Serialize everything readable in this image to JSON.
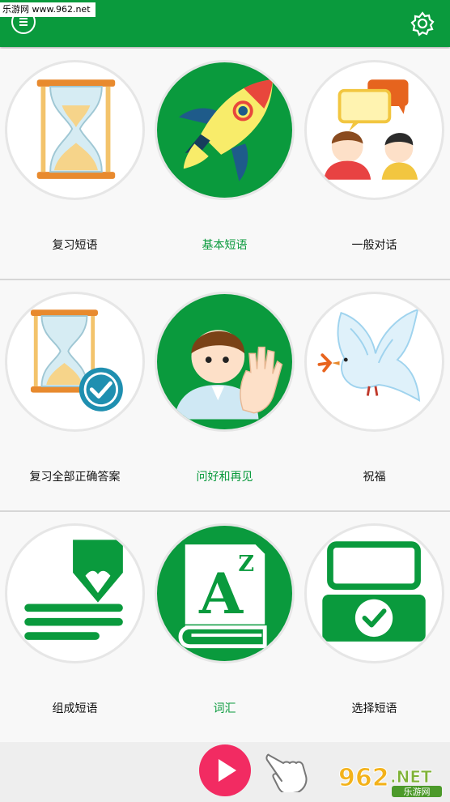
{
  "watermark_top": "乐游网 www.962.net",
  "header": {
    "menu_icon": "hamburger-menu-icon",
    "settings_icon": "gear-icon",
    "color": "#0a9a3d"
  },
  "sections": [
    {
      "items": [
        {
          "label": "复习短语",
          "icon": "hourglass-icon",
          "active": false
        },
        {
          "label": "基本短语",
          "icon": "rocket-icon",
          "active": true
        },
        {
          "label": "一般对话",
          "icon": "conversation-icon",
          "active": false
        }
      ]
    },
    {
      "items": [
        {
          "label": "复习全部正确答案",
          "icon": "hourglass-check-icon",
          "active": false
        },
        {
          "label": "问好和再见",
          "icon": "waving-person-icon",
          "active": true
        },
        {
          "label": "祝福",
          "icon": "dove-icon",
          "active": false
        }
      ]
    },
    {
      "items": [
        {
          "label": "组成短语",
          "icon": "pencil-lines-icon",
          "active": false
        },
        {
          "label": "词汇",
          "icon": "dictionary-icon",
          "active": true
        },
        {
          "label": "选择短语",
          "icon": "select-check-icon",
          "active": false
        }
      ]
    }
  ],
  "footer": {
    "play_icon": "play-icon",
    "hand_icon": "pointing-hand-icon",
    "logo": {
      "main": "962",
      "suffix": ".NET",
      "sub": "乐游网"
    }
  }
}
